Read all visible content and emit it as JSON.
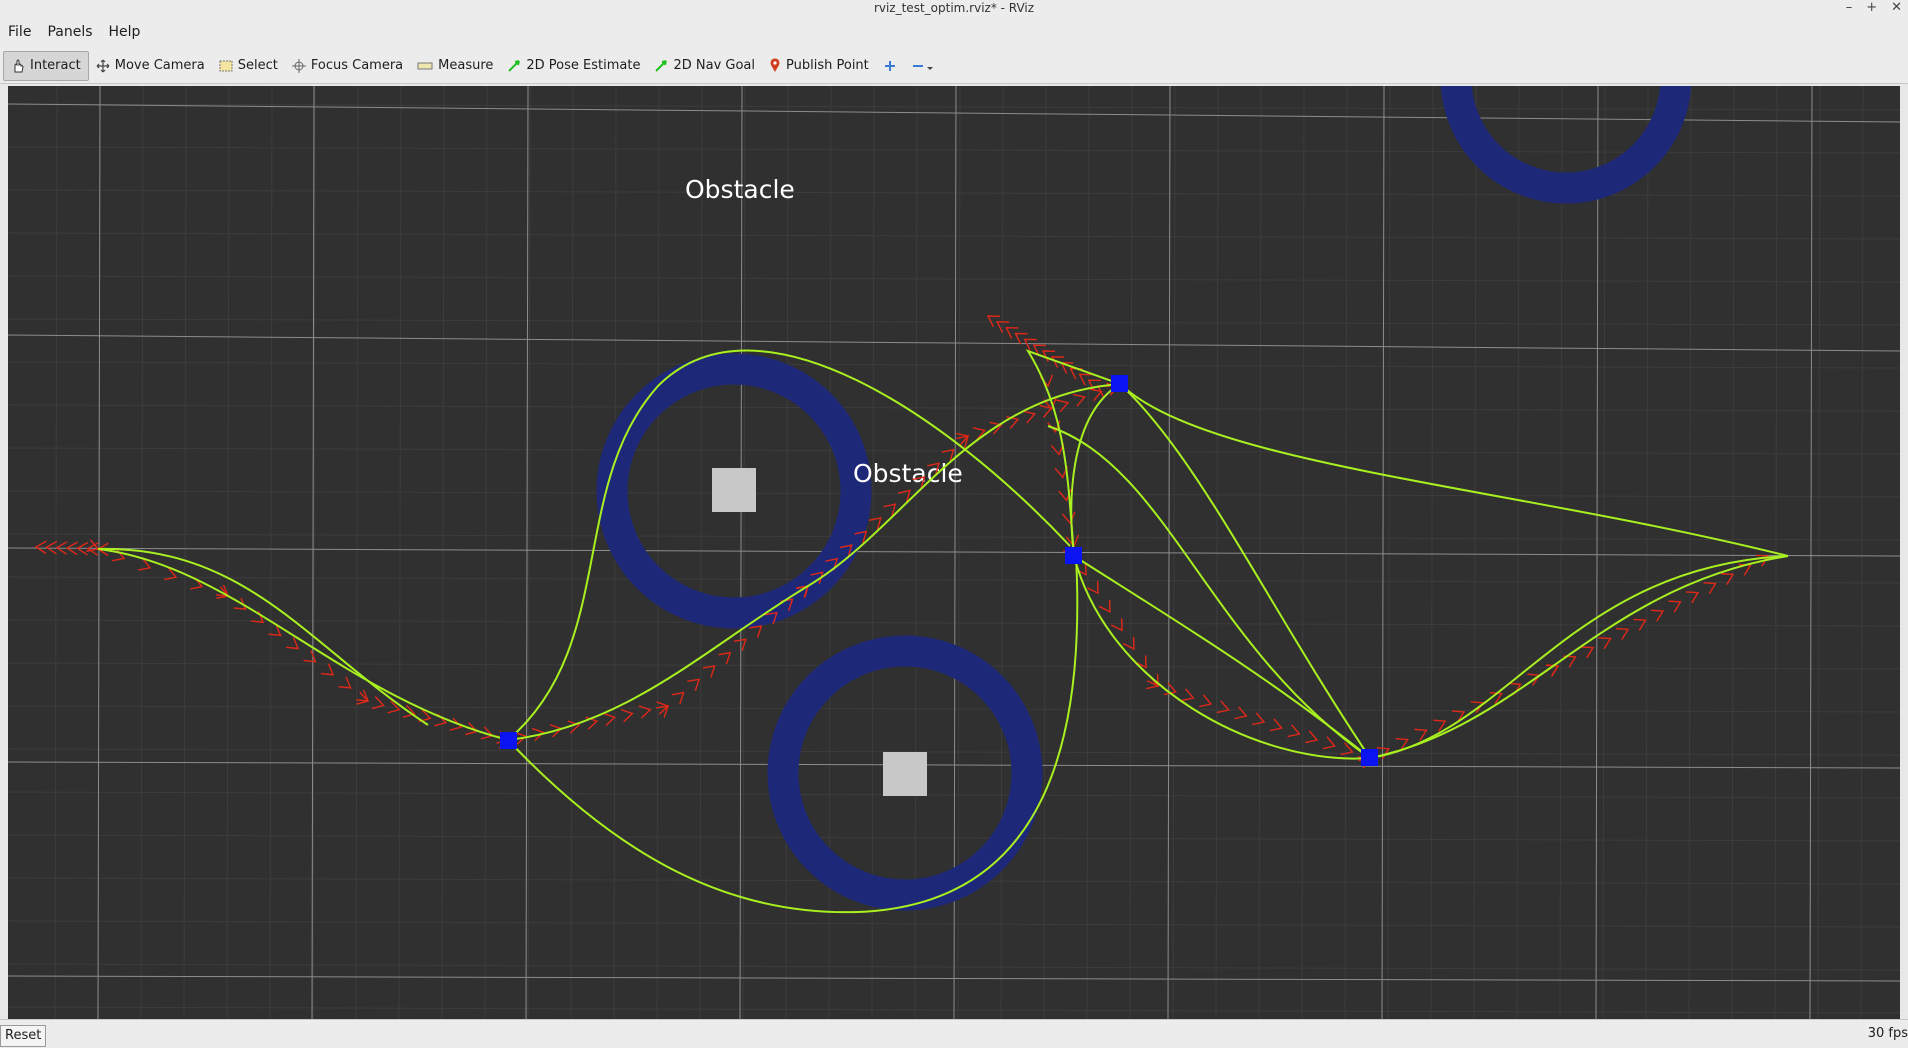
{
  "window": {
    "title": "rviz_test_optim.rviz* - RViz",
    "controls": [
      "–",
      "+",
      "✕"
    ]
  },
  "menubar": {
    "items": [
      {
        "label": "File"
      },
      {
        "label": "Panels"
      },
      {
        "label": "Help"
      }
    ]
  },
  "toolbar": {
    "tools": [
      {
        "label": "Interact",
        "icon": "hand-icon",
        "active": true
      },
      {
        "label": "Move Camera",
        "icon": "move-arrows-icon"
      },
      {
        "label": "Select",
        "icon": "select-box-icon"
      },
      {
        "label": "Focus Camera",
        "icon": "crosshair-icon"
      },
      {
        "label": "Measure",
        "icon": "ruler-icon"
      },
      {
        "label": "2D Pose Estimate",
        "icon": "green-arrow-icon"
      },
      {
        "label": "2D Nav Goal",
        "icon": "green-arrow-icon"
      },
      {
        "label": "Publish Point",
        "icon": "map-pin-icon"
      }
    ]
  },
  "viewport": {
    "labels": {
      "obstacle_top": "Obstacle",
      "obstacle_mid": "Obstacle"
    },
    "colors": {
      "background": "#303030",
      "grid": "#8c8c8c",
      "obstacle_ring": "#1e2878",
      "obstacle_core": "#c8c8c8",
      "path": "#a8f020",
      "pose_arrows": "#e02818",
      "waypoint": "#0a14f0"
    }
  },
  "statusbar": {
    "reset_label": "Reset",
    "fps": "30 fps"
  }
}
